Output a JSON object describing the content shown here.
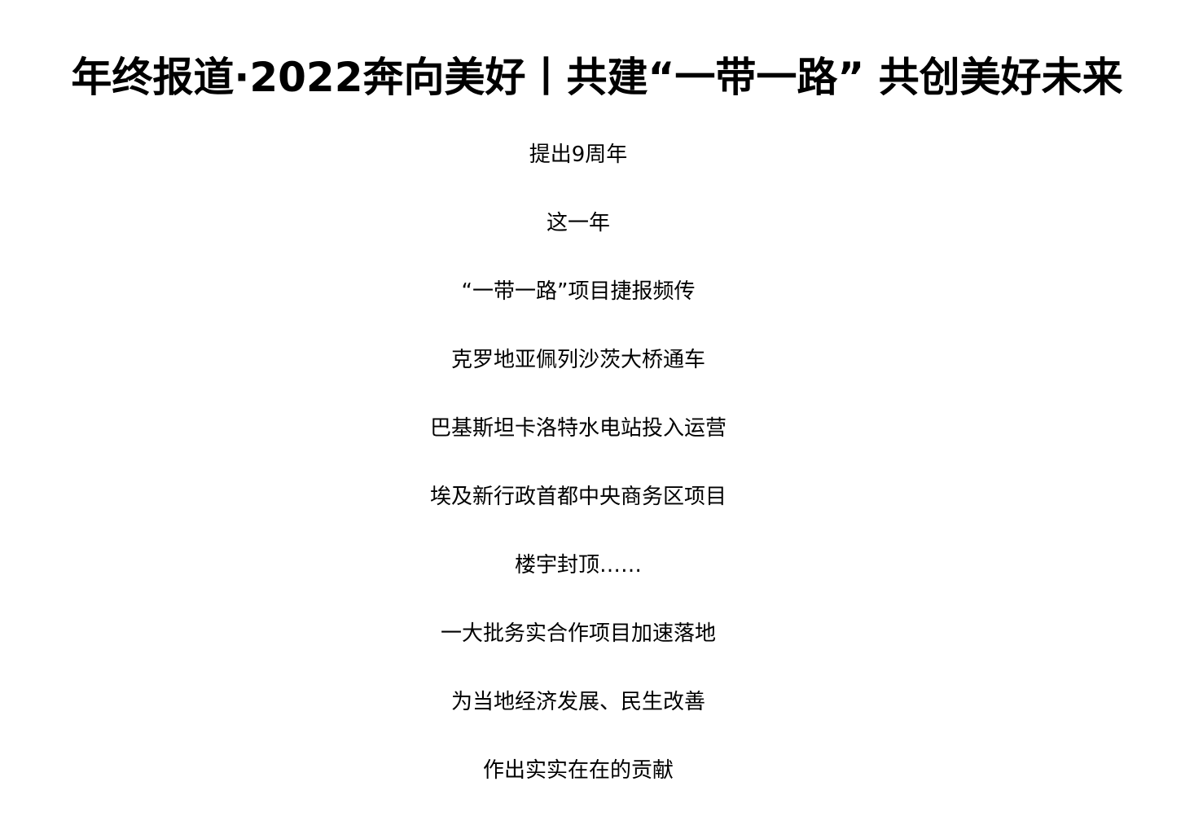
{
  "article": {
    "title": "年终报道·2022奔向美好丨共建“一带一路” 共创美好未来",
    "lines": [
      "提出9周年",
      "这一年",
      "“一带一路”项目捷报频传",
      "克罗地亚佩列沙茨大桥通车",
      "巴基斯坦卡洛特水电站投入运营",
      "埃及新行政首都中央商务区项目",
      "楼宇封顶……",
      "一大批务实合作项目加速落地",
      "为当地经济发展、民生改善",
      "作出实实在在的贡献"
    ]
  }
}
